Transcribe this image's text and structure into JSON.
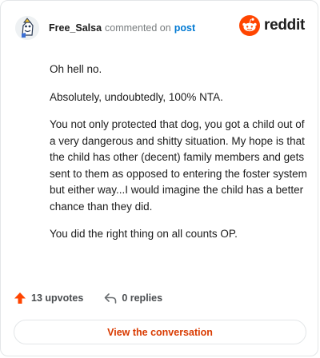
{
  "comment": {
    "username": "Free_Salsa",
    "action_text": "commented on",
    "post_link": "post",
    "paragraphs": [
      "Oh hell no.",
      "Absolutely, undoubtedly, 100% NTA.",
      "You not only protected that dog, you got a child out of a very dangerous and shitty situation. My hope is that the child has other (decent) family members and gets sent to them as opposed to entering the foster system but either way...I would imagine the child has a better chance than they did.",
      "You did the right thing on all counts OP."
    ]
  },
  "brand": {
    "name": "reddit",
    "logo_icon": "reddit-snoo-icon",
    "accent": "#ff4500"
  },
  "footer": {
    "upvotes_label": "13 upvotes",
    "upvote_icon": "upvote-arrow-icon",
    "upvote_color": "#ff4500",
    "replies_label": "0 replies",
    "reply_icon": "reply-arrow-icon"
  },
  "cta": {
    "view_label": "View the conversation",
    "color": "#d93a00"
  }
}
